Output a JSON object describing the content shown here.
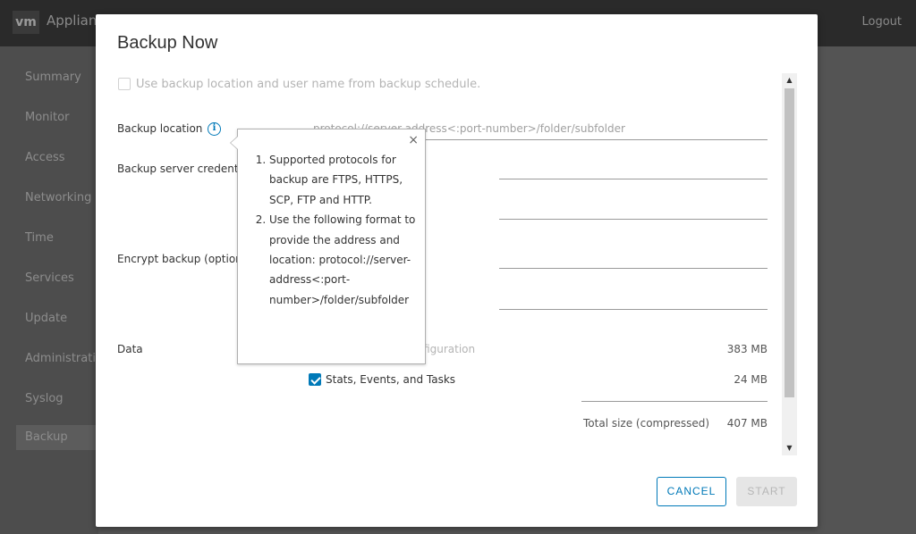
{
  "app": {
    "logo": "vm",
    "title": "Applian",
    "logout": "Logout"
  },
  "sidebar": {
    "items": [
      {
        "label": "Summary"
      },
      {
        "label": "Monitor"
      },
      {
        "label": "Access"
      },
      {
        "label": "Networking"
      },
      {
        "label": "Time"
      },
      {
        "label": "Services"
      },
      {
        "label": "Update"
      },
      {
        "label": "Administrati"
      },
      {
        "label": "Syslog"
      },
      {
        "label": "Backup"
      }
    ]
  },
  "modal": {
    "title": "Backup Now",
    "use_schedule_label": "Use backup location and user name from backup schedule.",
    "backup_location_label": "Backup location",
    "backup_location_placeholder": "protocol://server-address<:port-number>/folder/subfolder",
    "server_credentials_label": "Backup server credenti",
    "encrypt_label": "Encrypt backup (option",
    "data_label": "Data",
    "data_rows": [
      {
        "label": "Inventory and configuration",
        "size": "383 MB"
      },
      {
        "label": "Stats, Events, and Tasks",
        "size": "24 MB"
      }
    ],
    "total_label": "Total size (compressed)",
    "total_size": "407 MB",
    "cancel_label": "CANCEL",
    "start_label": "START"
  },
  "popover": {
    "close": "×",
    "item1": "Supported protocols for backup are FTPS, HTTPS, SCP, FTP and HTTP.",
    "item2": "Use the following format to provide the address and location: protocol://server-address<:port-number>/folder/subfolder"
  },
  "icons": {
    "info": "info-circle-icon",
    "close": "close-icon",
    "scroll_up": "caret-up-icon",
    "scroll_down": "caret-down-icon",
    "checkbox": "checkbox-icon"
  },
  "colors": {
    "accent": "#0079b8",
    "overlay": "#545454"
  }
}
